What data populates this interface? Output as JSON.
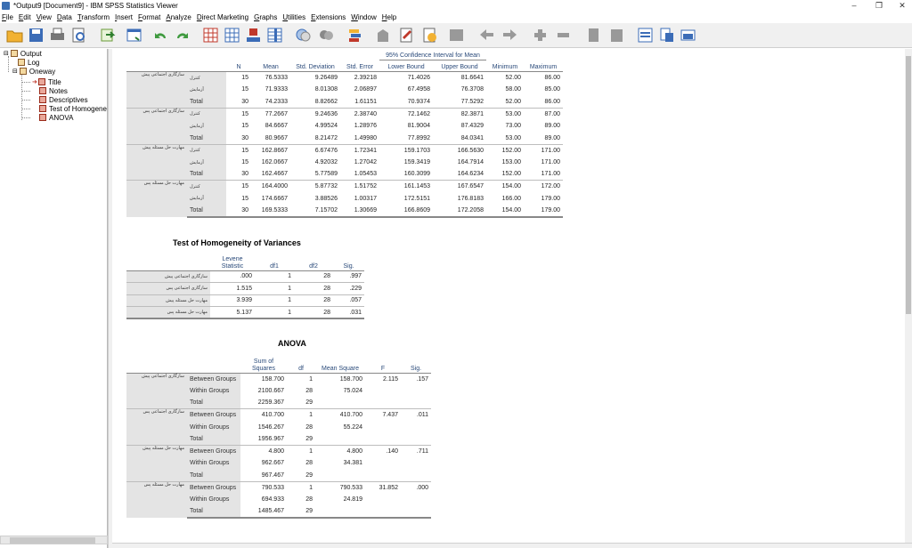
{
  "window": {
    "title": "*Output9 [Document9] - IBM SPSS Statistics Viewer",
    "controls": [
      "–",
      "❐",
      "✕"
    ]
  },
  "menu": [
    "File",
    "Edit",
    "View",
    "Data",
    "Transform",
    "Insert",
    "Format",
    "Analyze",
    "Direct Marketing",
    "Graphs",
    "Utilities",
    "Extensions",
    "Window",
    "Help"
  ],
  "outline": {
    "root": "Output",
    "log": "Log",
    "oneway": "Oneway",
    "items": [
      "Title",
      "Notes",
      "Descriptives",
      "Test of Homogene",
      "ANOVA"
    ]
  },
  "descriptives": {
    "header_ci": "95% Confidence Interval for Mean",
    "columns": [
      "N",
      "Mean",
      "Std. Deviation",
      "Std. Error",
      "Lower Bound",
      "Upper Bound",
      "Minimum",
      "Maximum"
    ],
    "groups": [
      {
        "var": "سازگاری اجتماعی پیش",
        "rows": [
          {
            "label": "کنترل",
            "vals": [
              "15",
              "76.5333",
              "9.26489",
              "2.39218",
              "71.4026",
              "81.6641",
              "52.00",
              "86.00"
            ]
          },
          {
            "label": "آزمایش",
            "vals": [
              "15",
              "71.9333",
              "8.01308",
              "2.06897",
              "67.4958",
              "76.3708",
              "58.00",
              "85.00"
            ]
          },
          {
            "label": "Total",
            "vals": [
              "30",
              "74.2333",
              "8.82662",
              "1.61151",
              "70.9374",
              "77.5292",
              "52.00",
              "86.00"
            ]
          }
        ]
      },
      {
        "var": "سازگاری اجتماعی پس",
        "rows": [
          {
            "label": "کنترل",
            "vals": [
              "15",
              "77.2667",
              "9.24636",
              "2.38740",
              "72.1462",
              "82.3871",
              "53.00",
              "87.00"
            ]
          },
          {
            "label": "آزمایش",
            "vals": [
              "15",
              "84.6667",
              "4.99524",
              "1.28976",
              "81.9004",
              "87.4329",
              "73.00",
              "89.00"
            ]
          },
          {
            "label": "Total",
            "vals": [
              "30",
              "80.9667",
              "8.21472",
              "1.49980",
              "77.8992",
              "84.0341",
              "53.00",
              "89.00"
            ]
          }
        ]
      },
      {
        "var": "مهارت حل مسئله پیش",
        "rows": [
          {
            "label": "کنترل",
            "vals": [
              "15",
              "162.8667",
              "6.67476",
              "1.72341",
              "159.1703",
              "166.5630",
              "152.00",
              "171.00"
            ]
          },
          {
            "label": "آزمایش",
            "vals": [
              "15",
              "162.0667",
              "4.92032",
              "1.27042",
              "159.3419",
              "164.7914",
              "153.00",
              "171.00"
            ]
          },
          {
            "label": "Total",
            "vals": [
              "30",
              "162.4667",
              "5.77589",
              "1.05453",
              "160.3099",
              "164.6234",
              "152.00",
              "171.00"
            ]
          }
        ]
      },
      {
        "var": "مهارت حل مسئله پس",
        "rows": [
          {
            "label": "کنترل",
            "vals": [
              "15",
              "164.4000",
              "5.87732",
              "1.51752",
              "161.1453",
              "167.6547",
              "154.00",
              "172.00"
            ]
          },
          {
            "label": "آزمایش",
            "vals": [
              "15",
              "174.6667",
              "3.88526",
              "1.00317",
              "172.5151",
              "176.8183",
              "166.00",
              "179.00"
            ]
          },
          {
            "label": "Total",
            "vals": [
              "30",
              "169.5333",
              "7.15702",
              "1.30669",
              "166.8609",
              "172.2058",
              "154.00",
              "179.00"
            ]
          }
        ]
      }
    ]
  },
  "homogeneity": {
    "title": "Test of Homogeneity of Variances",
    "columns": [
      "Levene Statistic",
      "df1",
      "df2",
      "Sig."
    ],
    "rows": [
      {
        "label": "سازگاری اجتماعی پیش",
        "vals": [
          ".000",
          "1",
          "28",
          ".997"
        ]
      },
      {
        "label": "سازگاری اجتماعی پس",
        "vals": [
          "1.515",
          "1",
          "28",
          ".229"
        ]
      },
      {
        "label": "مهارت حل مسئله پیش",
        "vals": [
          "3.939",
          "1",
          "28",
          ".057"
        ]
      },
      {
        "label": "مهارت حل مسئله پس",
        "vals": [
          "5.137",
          "1",
          "28",
          ".031"
        ]
      }
    ]
  },
  "anova": {
    "title": "ANOVA",
    "columns": [
      "Sum of Squares",
      "df",
      "Mean Square",
      "F",
      "Sig."
    ],
    "groups": [
      {
        "var": "سازگاری اجتماعی پیش",
        "rows": [
          {
            "label": "Between Groups",
            "vals": [
              "158.700",
              "1",
              "158.700",
              "2.115",
              ".157"
            ]
          },
          {
            "label": "Within Groups",
            "vals": [
              "2100.667",
              "28",
              "75.024",
              "",
              ""
            ]
          },
          {
            "label": "Total",
            "vals": [
              "2259.367",
              "29",
              "",
              "",
              ""
            ]
          }
        ]
      },
      {
        "var": "سازگاری اجتماعی پس",
        "rows": [
          {
            "label": "Between Groups",
            "vals": [
              "410.700",
              "1",
              "410.700",
              "7.437",
              ".011"
            ]
          },
          {
            "label": "Within Groups",
            "vals": [
              "1546.267",
              "28",
              "55.224",
              "",
              ""
            ]
          },
          {
            "label": "Total",
            "vals": [
              "1956.967",
              "29",
              "",
              "",
              ""
            ]
          }
        ]
      },
      {
        "var": "مهارت حل مسئله پیش",
        "rows": [
          {
            "label": "Between Groups",
            "vals": [
              "4.800",
              "1",
              "4.800",
              ".140",
              ".711"
            ]
          },
          {
            "label": "Within Groups",
            "vals": [
              "962.667",
              "28",
              "34.381",
              "",
              ""
            ]
          },
          {
            "label": "Total",
            "vals": [
              "967.467",
              "29",
              "",
              "",
              ""
            ]
          }
        ]
      },
      {
        "var": "مهارت حل مسئله پس",
        "rows": [
          {
            "label": "Between Groups",
            "vals": [
              "790.533",
              "1",
              "790.533",
              "31.852",
              ".000"
            ]
          },
          {
            "label": "Within Groups",
            "vals": [
              "694.933",
              "28",
              "24.819",
              "",
              ""
            ]
          },
          {
            "label": "Total",
            "vals": [
              "1485.467",
              "29",
              "",
              "",
              ""
            ]
          }
        ]
      }
    ]
  }
}
